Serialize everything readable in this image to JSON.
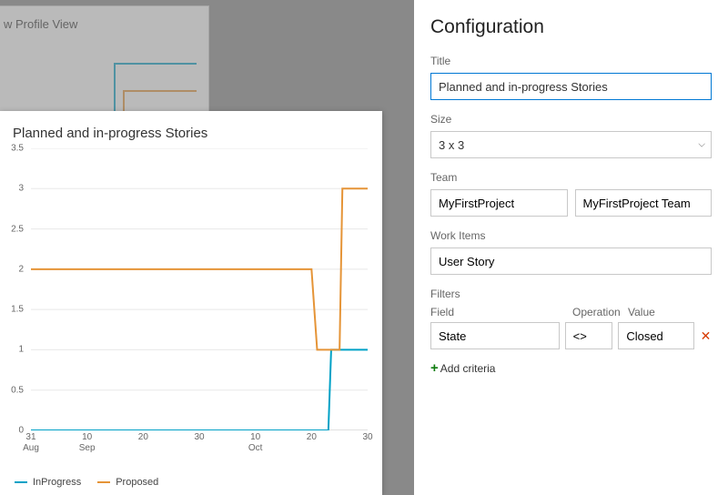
{
  "background_tile_title": "w Profile View",
  "preview": {
    "title": "Planned and in-progress Stories"
  },
  "chart_data": {
    "type": "line",
    "title": "Planned and in-progress Stories",
    "ylabel": "",
    "xlabel": "",
    "ylim": [
      0,
      3.5
    ],
    "y_ticks": [
      0,
      0.5,
      1,
      1.5,
      2,
      2.5,
      3,
      3.5
    ],
    "x_ticks": [
      {
        "label": "31",
        "sub": "Aug"
      },
      {
        "label": "10",
        "sub": "Sep"
      },
      {
        "label": "20",
        "sub": ""
      },
      {
        "label": "30",
        "sub": ""
      },
      {
        "label": "10",
        "sub": "Oct"
      },
      {
        "label": "20",
        "sub": ""
      },
      {
        "label": "30",
        "sub": ""
      }
    ],
    "series": [
      {
        "name": "InProgress",
        "color": "#00a1c6",
        "points": [
          [
            0,
            0
          ],
          [
            53,
            0
          ],
          [
            53.5,
            1
          ],
          [
            60,
            1
          ]
        ]
      },
      {
        "name": "Proposed",
        "color": "#e59437",
        "points": [
          [
            0,
            2
          ],
          [
            50,
            2
          ],
          [
            51,
            1
          ],
          [
            55,
            1
          ],
          [
            55.5,
            3
          ],
          [
            60,
            3
          ]
        ]
      }
    ],
    "x_domain": [
      0,
      60
    ]
  },
  "legend": {
    "inprogress": "InProgress",
    "proposed": "Proposed"
  },
  "config": {
    "heading": "Configuration",
    "labels": {
      "title": "Title",
      "size": "Size",
      "team": "Team",
      "work_items": "Work Items",
      "filters": "Filters",
      "field": "Field",
      "operation": "Operation",
      "value": "Value",
      "add_criteria": "Add criteria"
    },
    "title_value": "Planned and in-progress Stories",
    "size_value": "3 x 3",
    "team_project": "MyFirstProject",
    "team_name": "MyFirstProject Team",
    "work_items_value": "User Story",
    "filter": {
      "field": "State",
      "operation": "<>",
      "value": "Closed"
    }
  }
}
